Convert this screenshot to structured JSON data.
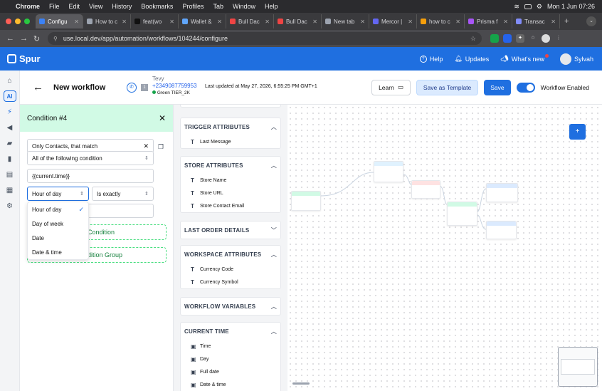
{
  "macos": {
    "app": "Chrome",
    "menus": [
      "File",
      "Edit",
      "View",
      "History",
      "Bookmarks",
      "Profiles",
      "Tab",
      "Window",
      "Help"
    ],
    "clock": "Mon 1 Jun  07:26"
  },
  "browser": {
    "tabs": [
      {
        "label": "Configu",
        "color": "#3b82f6",
        "active": true
      },
      {
        "label": "How to c",
        "color": "#9ca3af"
      },
      {
        "label": "feat(wo",
        "color": "#111"
      },
      {
        "label": "Wallet &",
        "color": "#60a5fa"
      },
      {
        "label": "Bull Dac",
        "color": "#ef4444"
      },
      {
        "label": "Bull Dac",
        "color": "#ef4444"
      },
      {
        "label": "New tab",
        "color": "#9ca3af"
      },
      {
        "label": "Mercor |",
        "color": "#6366f1"
      },
      {
        "label": "how to c",
        "color": "#f59e0b"
      },
      {
        "label": "Prisma f",
        "color": "#a855f7"
      },
      {
        "label": "Transac",
        "color": "#818cf8"
      }
    ],
    "url": "use.local.dev/app/automation/workflows/104244/configure"
  },
  "app": {
    "brand": "Spur",
    "nav": {
      "help": "Help",
      "updates": "Updates",
      "whats_new": "What's new",
      "user": "Sylvah"
    }
  },
  "sidebar": {
    "ai_label": "AI"
  },
  "header": {
    "title": "New workflow",
    "contact_name": "Tevy",
    "contact_phone": "+2349087759953",
    "contact_status": "Green",
    "contact_tier": "TIER_2K",
    "contact_num": "1",
    "last_updated": "Last updated at May 27, 2026, 6:55:25 PM GMT+1",
    "learn": "Learn",
    "save_template": "Save as Template",
    "save": "Save",
    "workflow_enabled": "Workflow Enabled"
  },
  "condition": {
    "title": "Condition #4",
    "match_label": "Only Contacts, that match",
    "condition_select": "All of the following condition",
    "variable": "{{current.time}}",
    "unit_select": "Hour of day",
    "operator_select": "Is exactly",
    "unit_options": [
      {
        "label": "Hour of day",
        "selected": true
      },
      {
        "label": "Day of week",
        "selected": false
      },
      {
        "label": "Date",
        "selected": false
      },
      {
        "label": "Date & time",
        "selected": false
      }
    ],
    "add_condition": "Condition",
    "add_group": "dition Group"
  },
  "variables": {
    "trigger": {
      "title": "TRIGGER ATTRIBUTES",
      "items": [
        "Last Message"
      ]
    },
    "store": {
      "title": "STORE ATTRIBUTES",
      "items": [
        "Store Name",
        "Store URL",
        "Store Contact Email"
      ]
    },
    "last_order": {
      "title": "LAST ORDER DETAILS"
    },
    "workspace": {
      "title": "WORKSPACE ATTRIBUTES",
      "items": [
        "Currency Code",
        "Currency Symbol"
      ]
    },
    "workflow_vars": {
      "title": "WORKFLOW VARIABLES"
    },
    "current_time": {
      "title": "CURRENT TIME",
      "items": [
        "Time",
        "Day",
        "Full date",
        "Date & time"
      ]
    }
  },
  "canvas": {
    "add_label": "+"
  }
}
